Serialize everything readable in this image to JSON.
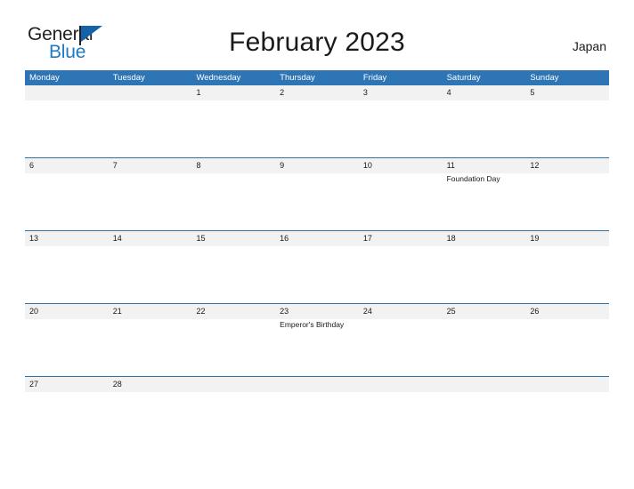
{
  "logo": {
    "word_one": "General",
    "word_two": "Blue",
    "color_dark": "#231f20",
    "color_blue": "#1f7ac4",
    "flag_icon": "blue-triangle-flag-icon"
  },
  "header": {
    "title": "February 2023",
    "country": "Japan"
  },
  "theme": {
    "header_blue": "#2e75b6",
    "divider_blue": "#2f6fa8",
    "band_gray": "#f2f2f2",
    "text_dark": "#1a1a1a"
  },
  "calendar": {
    "month": "February",
    "year": "2023",
    "weekdays": [
      "Monday",
      "Tuesday",
      "Wednesday",
      "Thursday",
      "Friday",
      "Saturday",
      "Sunday"
    ],
    "weeks": [
      {
        "short": false,
        "days": [
          {
            "num": "",
            "empty": true,
            "events": []
          },
          {
            "num": "",
            "empty": true,
            "events": []
          },
          {
            "num": "1",
            "empty": false,
            "events": []
          },
          {
            "num": "2",
            "empty": false,
            "events": []
          },
          {
            "num": "3",
            "empty": false,
            "events": []
          },
          {
            "num": "4",
            "empty": false,
            "events": []
          },
          {
            "num": "5",
            "empty": false,
            "events": []
          }
        ]
      },
      {
        "short": false,
        "days": [
          {
            "num": "6",
            "empty": false,
            "events": []
          },
          {
            "num": "7",
            "empty": false,
            "events": []
          },
          {
            "num": "8",
            "empty": false,
            "events": []
          },
          {
            "num": "9",
            "empty": false,
            "events": []
          },
          {
            "num": "10",
            "empty": false,
            "events": []
          },
          {
            "num": "11",
            "empty": false,
            "events": [
              "Foundation Day"
            ]
          },
          {
            "num": "12",
            "empty": false,
            "events": []
          }
        ]
      },
      {
        "short": false,
        "days": [
          {
            "num": "13",
            "empty": false,
            "events": []
          },
          {
            "num": "14",
            "empty": false,
            "events": []
          },
          {
            "num": "15",
            "empty": false,
            "events": []
          },
          {
            "num": "16",
            "empty": false,
            "events": []
          },
          {
            "num": "17",
            "empty": false,
            "events": []
          },
          {
            "num": "18",
            "empty": false,
            "events": []
          },
          {
            "num": "19",
            "empty": false,
            "events": []
          }
        ]
      },
      {
        "short": false,
        "days": [
          {
            "num": "20",
            "empty": false,
            "events": []
          },
          {
            "num": "21",
            "empty": false,
            "events": []
          },
          {
            "num": "22",
            "empty": false,
            "events": []
          },
          {
            "num": "23",
            "empty": false,
            "events": [
              "Emperor's Birthday"
            ]
          },
          {
            "num": "24",
            "empty": false,
            "events": []
          },
          {
            "num": "25",
            "empty": false,
            "events": []
          },
          {
            "num": "26",
            "empty": false,
            "events": []
          }
        ]
      },
      {
        "short": true,
        "days": [
          {
            "num": "27",
            "empty": false,
            "events": []
          },
          {
            "num": "28",
            "empty": false,
            "events": []
          },
          {
            "num": "",
            "empty": true,
            "events": []
          },
          {
            "num": "",
            "empty": true,
            "events": []
          },
          {
            "num": "",
            "empty": true,
            "events": []
          },
          {
            "num": "",
            "empty": true,
            "events": []
          },
          {
            "num": "",
            "empty": true,
            "events": []
          }
        ]
      }
    ]
  }
}
